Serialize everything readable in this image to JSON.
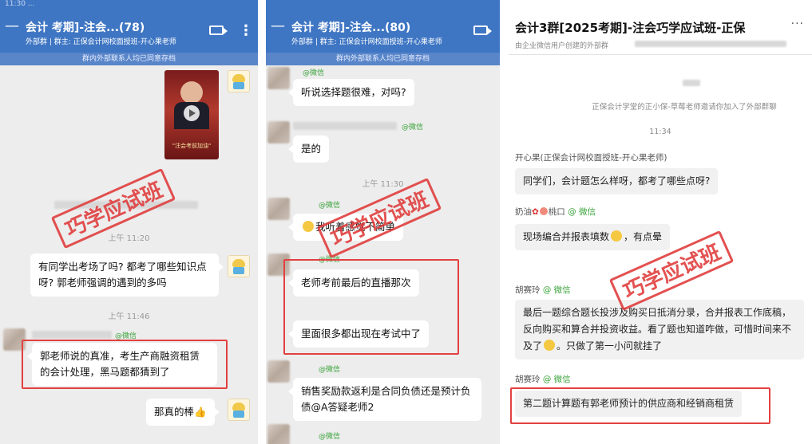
{
  "panel1": {
    "status": "11:30 ...",
    "title": "会计        考期]-注会...(78)",
    "subtitle": "外部群 | 群主: 正保会计网校面授班-开心果老师",
    "system_banner": "群内外部联系人均已同意存档",
    "time1": "上午 11:20",
    "msg1": "有同学出考场了吗? 都考了哪些知识点呀? 郭老师强调的遇到的多吗",
    "time2": "上午 11:46",
    "wechat_tag": "@微信",
    "msg2": "郭老师说的真准，考生产商融资租赁的会计处理，黑马题都猜到了",
    "msg3": "那真的棒👍",
    "video_caption": "\"注会考前加油\""
  },
  "panel2": {
    "title": "会计        考期]-注会...(80)",
    "subtitle": "外部群 | 群主: 正保会计网校面授班-开心果老师",
    "system_banner": "群内外部联系人均已同意存档",
    "wechat_tag": "@微信",
    "msg1": "听说选择题很难，对吗?",
    "msg2": "是的",
    "time1": "上午 11:30",
    "msg3": "我听着感觉不简单",
    "msg4": "老师考前最后的直播那次",
    "msg5": "里面很多都出现在考试中了",
    "msg6": "销售奖励款返利是合同负债还是预计负债@A答疑老师2"
  },
  "panel3": {
    "title": "会计3群[2025考期]-注会巧学应试班-正保",
    "subtitle": "由企业微信用户创建的外部群",
    "more": "···",
    "sys_notice": "正保会计学堂的正小保-草莓老师邀请你加入了外部群聊",
    "time": "11:34",
    "name1": "开心果(正保会计网校面授班-开心果老师)",
    "msg1": "同学们，会计题怎么样呀，都考了哪些点呀?",
    "name2_prefix": "奶油",
    "name2_suffix": "桃口",
    "wechat_tag": "@ 微信",
    "msg2": "现场编合并报表填数",
    "msg2_tail": "，有点晕",
    "name3": "胡赛玲",
    "msg3": "最后一题综合题长投涉及购买日抵消分录，合并报表工作底稿，反向购买和算合并投资收益。看了题也知道咋做，可惜时间来不及了",
    "msg3_tail": "。只做了第一小问就挂了",
    "name4": "胡赛玲",
    "msg4": "第二题计算题有郭老师预计的供应商和经销商租赁"
  },
  "stamp_text": "巧学应试班",
  "colors": {
    "header_blue": "#3f76c3",
    "stamp_red": "#e03a3a",
    "wechat_green": "#3aa33a"
  }
}
